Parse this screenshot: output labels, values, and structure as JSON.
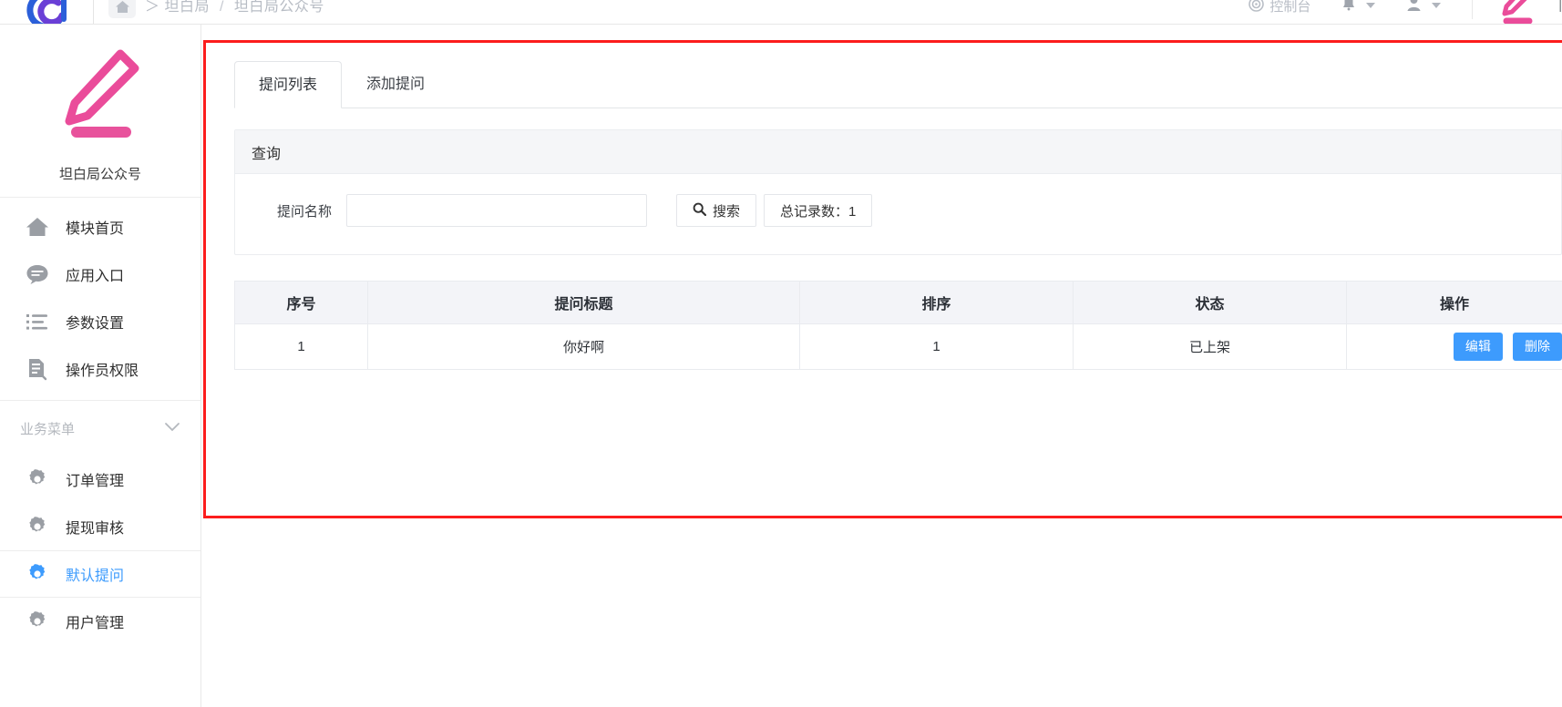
{
  "topbar": {
    "logo_icon": "spiral-logo-icon",
    "home_icon": "home-icon",
    "breadcrumb_sep": "＞",
    "breadcrumb_items": [
      "坦白局",
      "坦白局公众号"
    ],
    "console_label": "控制台",
    "console_icon": "target-icon",
    "bell_icon": "bell-icon",
    "user_icon": "user-icon",
    "brand_icon": "pencil-icon"
  },
  "sidebar": {
    "brand_icon": "pencil-icon",
    "brand_name": "坦白局公众号",
    "primary_items": [
      {
        "label": "模块首页",
        "icon": "home-icon"
      },
      {
        "label": "应用入口",
        "icon": "chat-bubble-icon"
      },
      {
        "label": "参数设置",
        "icon": "list-icon"
      },
      {
        "label": "操作员权限",
        "icon": "document-edit-icon"
      }
    ],
    "section": {
      "label": "业务菜单",
      "icon": "chevron-down-icon"
    },
    "business_items": [
      {
        "label": "订单管理",
        "icon": "gear-icon",
        "active": false
      },
      {
        "label": "提现审核",
        "icon": "gear-icon",
        "active": false
      },
      {
        "label": "默认提问",
        "icon": "gear-icon",
        "active": true
      },
      {
        "label": "用户管理",
        "icon": "gear-icon",
        "active": false
      }
    ]
  },
  "main": {
    "tabs": [
      {
        "label": "提问列表",
        "active": true
      },
      {
        "label": "添加提问",
        "active": false
      }
    ],
    "query_panel": {
      "title": "查询",
      "field_label": "提问名称",
      "field_value": "",
      "field_placeholder": "",
      "search_button": "搜索",
      "search_icon": "search-icon",
      "count_button": "总记录数：1"
    },
    "table": {
      "headers": [
        "序号",
        "提问标题",
        "排序",
        "状态",
        "操作"
      ],
      "rows": [
        {
          "index": "1",
          "title": "你好啊",
          "sort": "1",
          "state": "已上架",
          "edit_label": "编辑",
          "delete_label": "删除"
        }
      ]
    }
  },
  "colors": {
    "accent_blue": "#3d9bfd",
    "brand_pink": "#ea4c9a",
    "highlight_red": "#fc1d1d"
  }
}
